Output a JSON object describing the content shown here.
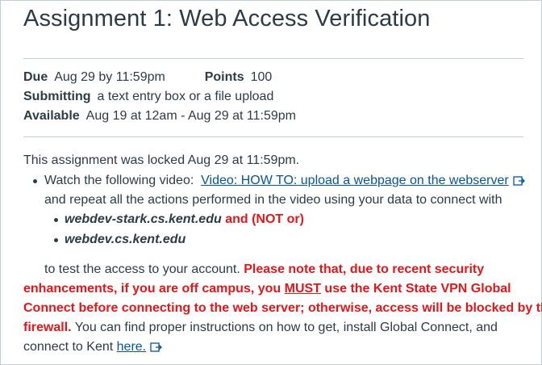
{
  "assignment": {
    "title": "Assignment 1: Web Access Verification",
    "due_label": "Due",
    "due_value": "Aug 29 by 11:59pm",
    "points_label": "Points",
    "points_value": "100",
    "submitting_label": "Submitting",
    "submitting_value": "a text entry box or a file upload",
    "available_label": "Available",
    "available_value": "Aug 19 at 12am - Aug 29 at 11:59pm"
  },
  "content": {
    "locked_notice": "This assignment was locked Aug 29 at 11:59pm.",
    "watch_prefix": "Watch the following video:",
    "video_link": "Video: HOW TO: upload a webpage on the webserver",
    "repeat_text": "and repeat all the actions performed in the video using your data to connect with",
    "server1": "webdev-stark.cs.kent.edu",
    "and_not_or": "and (NOT or)",
    "server2": "webdev.cs.kent.edu",
    "test_text": "to test the access to your account.",
    "note_1": "Please note that, due to recent security",
    "note_2a": "enhancements, if you are off campus, you",
    "note_must": "MUST",
    "note_2b": "use the Kent State VPN Global",
    "note_3": "Connect before connecting to the web server; otherwise, access will be blocked by the",
    "note_4": "firewall.",
    "instructions_1": "You can find proper instructions on how to get, install Global Connect, and",
    "instructions_2": "connect to Kent",
    "here_link": "here."
  },
  "icons": {
    "external_link": "external-link-icon"
  },
  "colors": {
    "text": "#2d3b45",
    "link": "#0b5394",
    "warning": "#e0181b",
    "divider": "#c7cdd1"
  }
}
